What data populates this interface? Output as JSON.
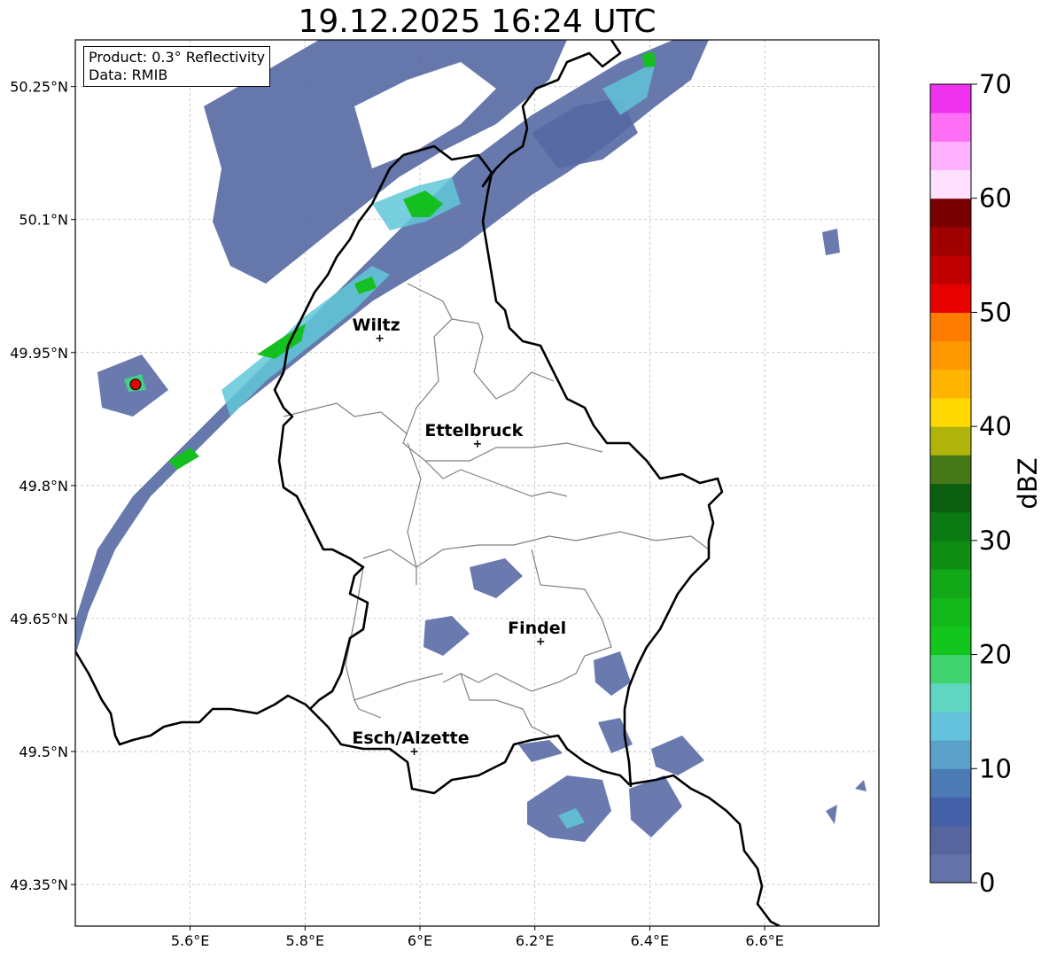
{
  "title": "19.12.2025 16:24 UTC",
  "infobox": {
    "product": "Product: 0.3° Reflectivity",
    "data": "Data: RMIB"
  },
  "map": {
    "lon_range": [
      5.4,
      6.8
    ],
    "lat_range": [
      49.3,
      50.3
    ],
    "lon_ticks": [
      {
        "value": 5.6,
        "label": "5.6°E"
      },
      {
        "value": 5.8,
        "label": "5.8°E"
      },
      {
        "value": 6.0,
        "label": "6°E"
      },
      {
        "value": 6.2,
        "label": "6.2°E"
      },
      {
        "value": 6.4,
        "label": "6.4°E"
      },
      {
        "value": 6.6,
        "label": "6.6°E"
      }
    ],
    "lat_ticks": [
      {
        "value": 50.25,
        "label": "50.25°N"
      },
      {
        "value": 50.1,
        "label": "50.1°N"
      },
      {
        "value": 49.95,
        "label": "49.95°N"
      },
      {
        "value": 49.8,
        "label": "49.8°N"
      },
      {
        "value": 49.65,
        "label": "49.65°N"
      },
      {
        "value": 49.5,
        "label": "49.5°N"
      },
      {
        "value": 49.35,
        "label": "49.35°N"
      }
    ],
    "grid": true,
    "cities": [
      {
        "name": "Wiltz",
        "lon": 5.93,
        "lat": 49.966
      },
      {
        "name": "Ettelbruck",
        "lon": 6.1,
        "lat": 49.847
      },
      {
        "name": "Findel",
        "lon": 6.21,
        "lat": 49.624
      },
      {
        "name": "Esch/Alzette",
        "lon": 5.99,
        "lat": 49.5
      }
    ],
    "radar_site": {
      "lon": 5.505,
      "lat": 49.914,
      "color": "#e00000"
    }
  },
  "colorbar": {
    "label": "dBZ",
    "min": 0,
    "max": 70,
    "ticks": [
      {
        "value": 0,
        "label": "0"
      },
      {
        "value": 10,
        "label": "10"
      },
      {
        "value": 20,
        "label": "20"
      },
      {
        "value": 30,
        "label": "30"
      },
      {
        "value": 40,
        "label": "40"
      },
      {
        "value": 50,
        "label": "50"
      },
      {
        "value": 60,
        "label": "60"
      },
      {
        "value": 70,
        "label": "70"
      }
    ],
    "colors": [
      "#6574a8",
      "#56659e",
      "#4460a8",
      "#4c7ab5",
      "#5aa0c8",
      "#65c2dc",
      "#60d6c0",
      "#40d470",
      "#12c61e",
      "#14b81a",
      "#12a818",
      "#0e8c14",
      "#0c7a12",
      "#0a5e0e",
      "#46781a",
      "#b0b40a",
      "#ffd800",
      "#ffb400",
      "#ff9800",
      "#ff7c00",
      "#e60000",
      "#c00000",
      "#a00000",
      "#780000",
      "#ffe0ff",
      "#ffb0ff",
      "#ff70f6",
      "#ee32ee"
    ]
  }
}
